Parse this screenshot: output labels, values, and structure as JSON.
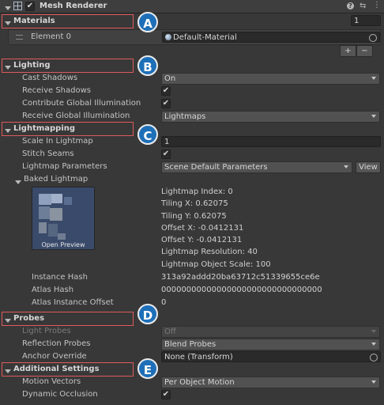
{
  "component": {
    "title": "Mesh Renderer",
    "enabled_checkmark": "✔"
  },
  "colors": {
    "highlight": "#e05a5a",
    "badge": "#1e6fb8",
    "background": "#383838"
  },
  "materials": {
    "label": "Materials",
    "size": "1",
    "element_label": "Element 0",
    "element_value": "Default-Material",
    "add_symbol": "+",
    "remove_symbol": "−"
  },
  "lighting": {
    "label": "Lighting",
    "cast_shadows_label": "Cast Shadows",
    "cast_shadows_value": "On",
    "receive_shadows_label": "Receive Shadows",
    "contribute_gi_label": "Contribute Global Illumination",
    "receive_gi_label": "Receive Global Illumination",
    "receive_gi_value": "Lightmaps"
  },
  "lightmapping": {
    "label": "Lightmapping",
    "scale_label": "Scale In Lightmap",
    "scale_value": "1",
    "stitch_label": "Stitch Seams",
    "params_label": "Lightmap Parameters",
    "params_value": "Scene Default Parameters",
    "view_button": "View",
    "baked_label": "Baked Lightmap",
    "open_preview": "Open Preview",
    "info": [
      "Lightmap Index: 0",
      "Tiling X: 0.62075",
      "Tiling Y: 0.62075",
      "Offset X: -0.0412131",
      "Offset Y: -0.0412131",
      "Lightmap Resolution: 40",
      "Lightmap Object Scale: 100"
    ],
    "instance_hash_label": "Instance Hash",
    "instance_hash_value": "313a92addd20ba63712c51339655ce6e",
    "atlas_hash_label": "Atlas Hash",
    "atlas_hash_value": "00000000000000000000000000000000",
    "atlas_offset_label": "Atlas Instance Offset",
    "atlas_offset_value": "0"
  },
  "probes": {
    "label": "Probes",
    "light_probes_label": "Light Probes",
    "light_probes_value": "Off",
    "reflection_label": "Reflection Probes",
    "reflection_value": "Blend Probes",
    "anchor_label": "Anchor Override",
    "anchor_value": "None (Transform)"
  },
  "additional": {
    "label": "Additional Settings",
    "motion_label": "Motion Vectors",
    "motion_value": "Per Object Motion",
    "occlusion_label": "Dynamic Occlusion"
  },
  "callouts": [
    "A",
    "B",
    "C",
    "D",
    "E"
  ]
}
